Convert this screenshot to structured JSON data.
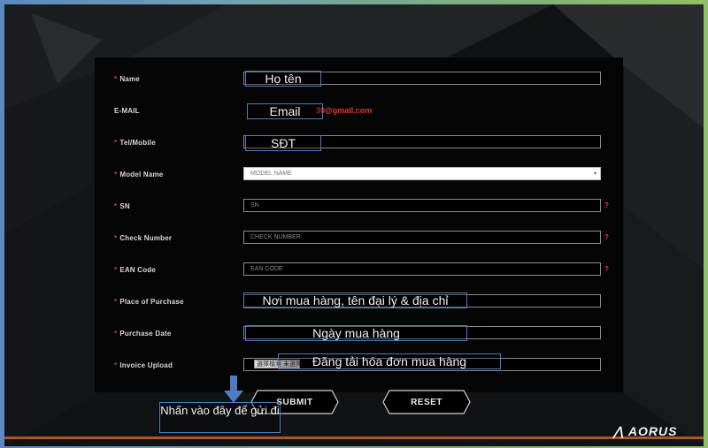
{
  "form": {
    "rows": [
      {
        "label": "Name",
        "required": true,
        "placeholder": ""
      },
      {
        "label": "E-MAIL",
        "required": false,
        "email_value": "30@gmail.com"
      },
      {
        "label": "Tel/Mobile",
        "required": true,
        "placeholder": ""
      },
      {
        "label": "Model Name",
        "required": true,
        "placeholder": "MODEL NAME"
      },
      {
        "label": "SN",
        "required": true,
        "placeholder": "SN"
      },
      {
        "label": "Check Number",
        "required": true,
        "placeholder": "CHECK NUMBER"
      },
      {
        "label": "EAN Code",
        "required": true,
        "placeholder": "EAN CODE"
      },
      {
        "label": "Place of Purchase",
        "required": true,
        "placeholder": ""
      },
      {
        "label": "Purchase Date",
        "required": true,
        "placeholder": ""
      },
      {
        "label": "Invoice Upload",
        "required": true,
        "placeholder": ""
      }
    ],
    "help_mark": "?",
    "upload_button": "選擇檔案 未選擇",
    "submit": "SUBMIT",
    "reset": "RESET"
  },
  "annotations": {
    "name": "Họ tên",
    "email": "Email",
    "phone": "SĐT",
    "place": "Nơi mua hàng, tên đại lý & địa chỉ",
    "date": "Ngày mua hàng",
    "invoice": "Đăng tải hóa đơn mua hàng",
    "submit_hint": "Nhấn vào đây để gửi đi"
  },
  "brand": {
    "logo": "AORUS"
  },
  "colors": {
    "accent": "#e03a2e",
    "annotation_border": "#4f7cc0",
    "page_bg": "#111214"
  }
}
